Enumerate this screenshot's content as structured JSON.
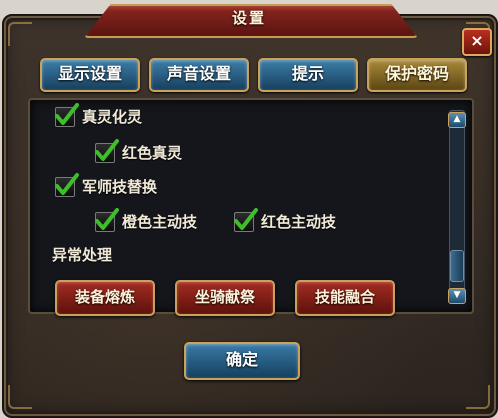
{
  "dialog": {
    "title": "设置",
    "close_label": "×"
  },
  "tabs": [
    {
      "label": "显示设置",
      "active": false
    },
    {
      "label": "声音设置",
      "active": false
    },
    {
      "label": "提示",
      "active": false
    },
    {
      "label": "保护密码",
      "active": true
    }
  ],
  "options": [
    {
      "label": "真灵化灵",
      "checked": true
    },
    {
      "label": "红色真灵",
      "checked": true
    },
    {
      "label": "军师技替换",
      "checked": true
    },
    {
      "label": "橙色主动技",
      "checked": true
    },
    {
      "label": "红色主动技",
      "checked": true
    }
  ],
  "section": {
    "heading": "异常处理"
  },
  "action_buttons": [
    {
      "label": "装备熔炼"
    },
    {
      "label": "坐骑献祭"
    },
    {
      "label": "技能融合"
    }
  ],
  "confirm_label": "确定",
  "colors": {
    "checkmark": "#3fbe2c",
    "tab_blue": "#2a5f86",
    "tab_active": "#a98a3a",
    "action_red": "#8e2219"
  }
}
